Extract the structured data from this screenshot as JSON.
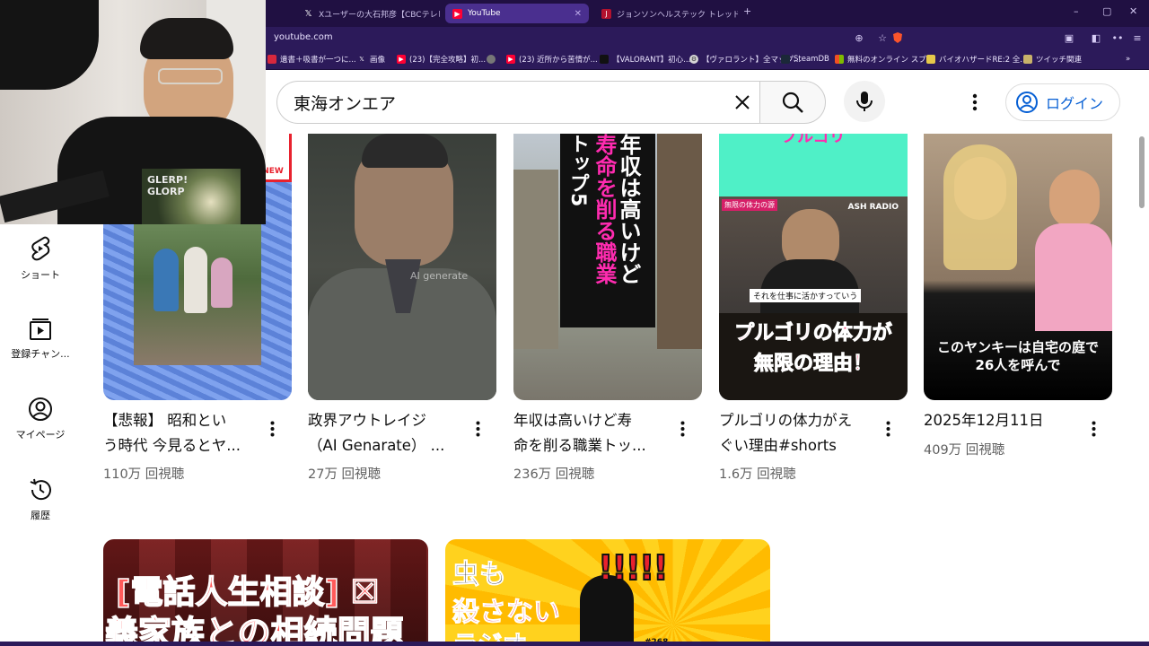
{
  "browser": {
    "tabs": [
      {
        "label": "Xユーザーの大石邦彦【CBCテレビ解説委",
        "icon": "x-logo-icon",
        "active": false
      },
      {
        "label": "YouTube",
        "icon": "youtube-icon",
        "active": true
      },
      {
        "label": "ジョンソンヘルステック トレッドミル 業務用",
        "icon": "johnson-icon",
        "active": false
      }
    ],
    "new_tab": "+",
    "url": "youtube.com",
    "window_controls": {
      "minimize": "–",
      "restore": "▢",
      "close": "✕"
    },
    "bookmarks": [
      {
        "label": "遺書＋吸書が一つに...",
        "icon": "red-square-icon"
      },
      {
        "label": "画像",
        "icon": "x-logo-icon"
      },
      {
        "label": "(23)【完全攻略】初...",
        "icon": "youtube-icon"
      },
      {
        "label": "",
        "icon": "globe-icon"
      },
      {
        "label": "(23) 近所から苦情が...",
        "icon": "youtube-icon"
      },
      {
        "label": "【VALORANT】初心...",
        "icon": "dark-square-icon"
      },
      {
        "label": "【ヴァロラント】全マップ...",
        "icon": "gear-circle-icon"
      },
      {
        "label": "SteamDB",
        "icon": "steamdb-icon"
      },
      {
        "label": "無料のオンライン スプ...",
        "icon": "microsoft-icon"
      },
      {
        "label": "バイオハザードRE:2 全...",
        "icon": "bookmark-icon"
      },
      {
        "label": "ツイッチ関連",
        "icon": "folder-icon"
      }
    ],
    "bookmark_overflow": "»"
  },
  "youtube": {
    "search": {
      "value": "東海オンエア",
      "placeholder": "検索"
    },
    "login_label": "ログイン",
    "sidebar": [
      {
        "label": "ショート",
        "icon": "shorts-icon"
      },
      {
        "label": "登録チャン...",
        "icon": "subscriptions-icon"
      },
      {
        "label": "マイページ",
        "icon": "my-page-icon"
      },
      {
        "label": "履歴",
        "icon": "history-icon"
      }
    ],
    "videos": [
      {
        "title_line1": "【悲報】 昭和とい",
        "title_line2": "う時代 今見るとヤ...",
        "views": "110万 回視聴"
      },
      {
        "title_line1": "政界アウトレイジ",
        "title_line2": "（AI Genarate） ...",
        "views": "27万 回視聴"
      },
      {
        "title_line1": "年収は高いけど寿",
        "title_line2": "命を削る職業トッ...",
        "views": "236万 回視聴"
      },
      {
        "title_line1": "プルゴリの体力がえ",
        "title_line2": "ぐい理由#shorts",
        "views": "1.6万 回視聴"
      },
      {
        "title_line1": "2025年12月11日",
        "title_line2": "",
        "views": "409万 回視聴"
      }
    ],
    "thumb_texts": {
      "t1_sticker": "NEW",
      "t2_watermark": "AI generate",
      "t3_vertical_1": "年収は高いけど",
      "t3_vertical_2": "寿命を削る職業",
      "t3_vertical_3": "トップ5",
      "t4_top": "プルゴリ",
      "t4_tag": "無限の体力の源",
      "t4_brand": "ASH RADIO",
      "t4_sub": "それを仕事に活かすっていう",
      "t4_big1": "プルゴリの体力が",
      "t4_big2": "無限の理由！",
      "t5_caption1": "このヤンキーは自宅の庭で",
      "t5_caption2": "26人を呼んで",
      "r2a_line1": "[電話人生相談] ☒",
      "r2a_line2": "義家族との相続問題",
      "r2b_line1": "虫も",
      "r2b_line2": "殺さない",
      "r2b_line3": "ラジオ",
      "r2b_marks": "!!!!!",
      "r2b_num": "#268"
    },
    "webcam_shirt": "GLERP! GLORP"
  },
  "colors": {
    "chrome_dark": "#201042",
    "chrome_mid": "#2c1a5a",
    "tab_active": "#4a2f8f",
    "yt_text": "#0f0f0f",
    "yt_meta": "#606060",
    "login_blue": "#065fd4",
    "shorts_red": "#ff0033"
  }
}
